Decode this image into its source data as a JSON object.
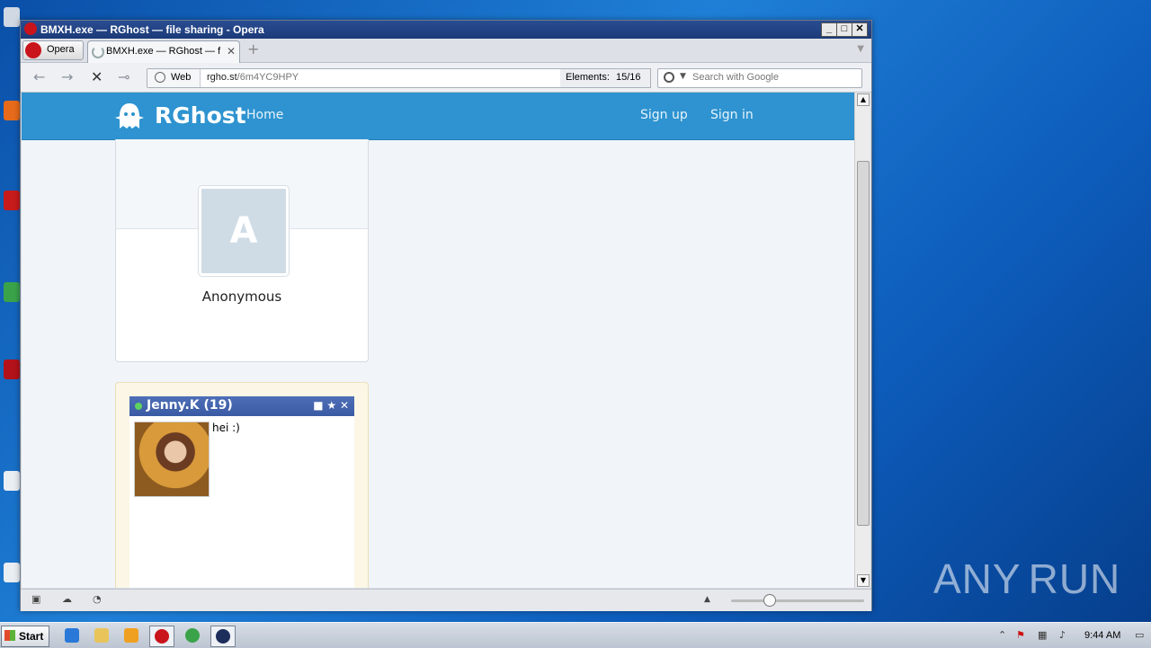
{
  "window": {
    "title": "BMXH.exe — RGhost — file sharing - Opera",
    "minimize": "_",
    "maximize": "□",
    "close": "✕"
  },
  "tabs": {
    "opera_menu_label": "Opera",
    "active_tab_title": "BMXH.exe — RGhost — f…",
    "active_tab_close": "✕",
    "new_tab": "+"
  },
  "addressbar": {
    "back": "←",
    "forward": "→",
    "stop": "✕",
    "key": "⊸",
    "web_label": "Web",
    "url_host": "rgho.st",
    "url_path": "/6m4YC9HPY",
    "elements_label": "Elements:",
    "elements_value": "15/16",
    "search_placeholder": "Search with Google"
  },
  "site": {
    "brand": "RGhost",
    "nav_home": "Home",
    "nav_signup": "Sign up",
    "nav_signin": "Sign in",
    "avatar_letter": "A",
    "username": "Anonymous"
  },
  "chat": {
    "name": "Jenny.K (19)",
    "icons": "■ ★ ✕",
    "message": "hei :)"
  },
  "taskbar": {
    "start": "Start",
    "clock": "9:44 AM"
  },
  "watermark": {
    "left": "ANY",
    "right": "RUN"
  }
}
